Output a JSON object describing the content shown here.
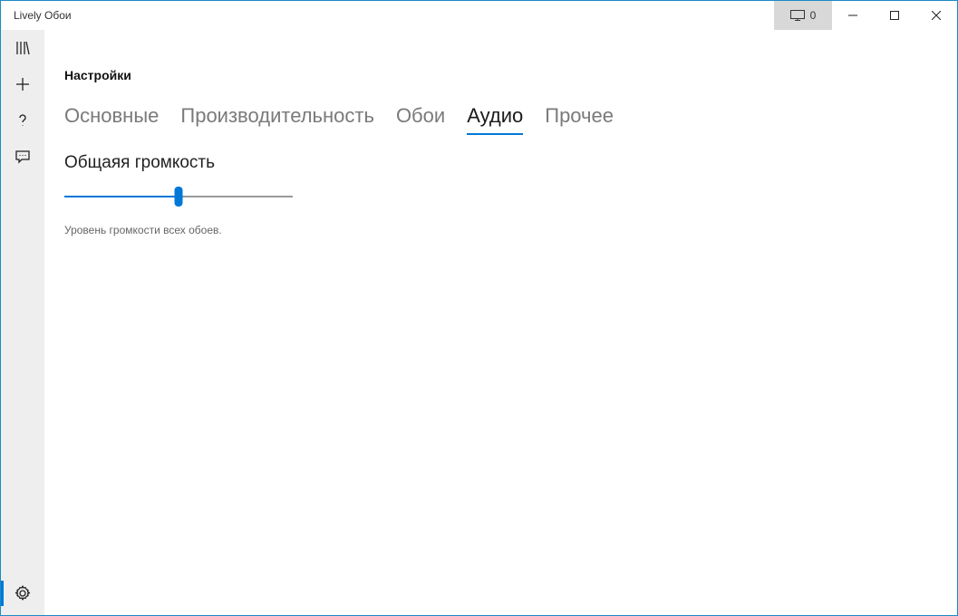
{
  "window": {
    "title": "Lively Обои",
    "display_count": "0"
  },
  "page": {
    "title": "Настройки"
  },
  "tabs": [
    {
      "label": "Основные",
      "active": false
    },
    {
      "label": "Производительность",
      "active": false
    },
    {
      "label": "Обои",
      "active": false
    },
    {
      "label": "Аудио",
      "active": true
    },
    {
      "label": "Прочее",
      "active": false
    }
  ],
  "audio": {
    "volume_heading": "Общаяя громкость",
    "volume_percent": 50,
    "volume_help": "Уровень громкости всех обоев."
  }
}
